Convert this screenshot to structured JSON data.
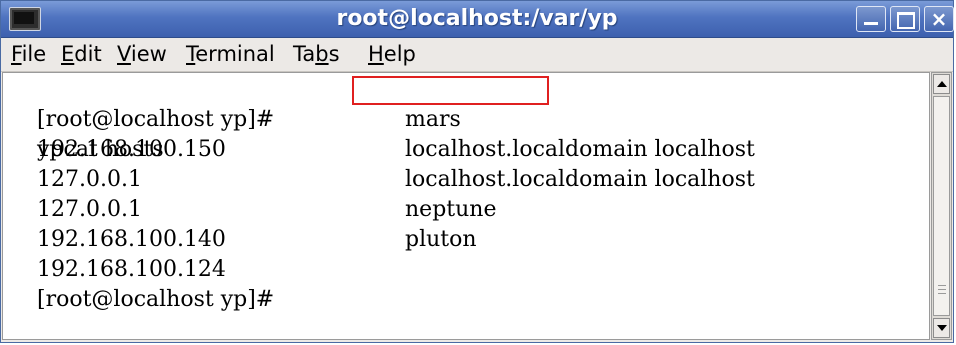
{
  "window": {
    "title": "root@localhost:/var/yp"
  },
  "menu": [
    {
      "label": "File",
      "accel": "F",
      "rest": "ile"
    },
    {
      "label": "Edit",
      "accel": "E",
      "rest": "dit"
    },
    {
      "label": "View",
      "accel": "V",
      "rest": "iew"
    },
    {
      "label": "Terminal",
      "accel": "T",
      "rest": "erminal"
    },
    {
      "label": "Tabs",
      "pre": "Ta",
      "accel": "b",
      "rest": "s"
    },
    {
      "label": "Help",
      "accel": "H",
      "rest": "elp"
    }
  ],
  "terminal": {
    "prompt": "[root@localhost yp]#",
    "command": "ypcat hosts",
    "rows": [
      {
        "ip": "192.168.100.150",
        "names": "mars"
      },
      {
        "ip": "127.0.0.1",
        "names": "localhost.localdomain localhost"
      },
      {
        "ip": "127.0.0.1",
        "names": "localhost.localdomain localhost"
      },
      {
        "ip": "192.168.100.140",
        "names": "neptune"
      },
      {
        "ip": "192.168.100.124",
        "names": "pluton"
      }
    ],
    "final_prompt": "[root@localhost yp]#"
  },
  "colors": {
    "titlebar": "#4f73c0",
    "highlight": "#e02020"
  }
}
